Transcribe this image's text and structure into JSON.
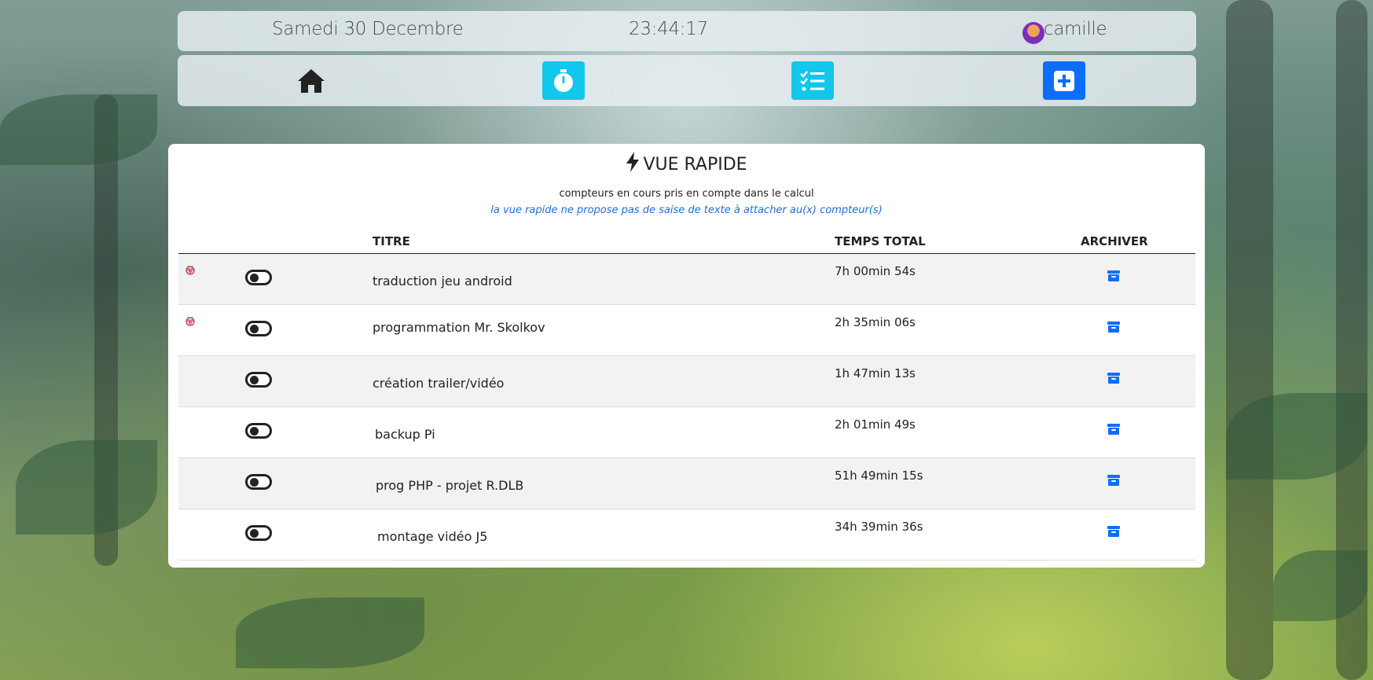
{
  "header": {
    "date": "Samedi 30 Decembre",
    "time": "23:44:17",
    "username": "camille",
    "avatar_icon": "user-avatar"
  },
  "nav": {
    "items": [
      {
        "icon": "home-icon"
      },
      {
        "icon": "stopwatch-icon"
      },
      {
        "icon": "task-list-icon"
      },
      {
        "icon": "add-square-icon"
      }
    ],
    "colors": {
      "cyan": "#13c6ec",
      "blue": "#0d6efd"
    }
  },
  "panel": {
    "title": "VUE RAPIDE",
    "title_icon": "bolt-icon",
    "subtitle": "compteurs en cours pris en compte dans le calcul",
    "note": "la vue rapide ne propose pas de saise de texte à attacher au(x) compteur(s)"
  },
  "table": {
    "headers": {
      "title": "TITRE",
      "total": "TEMPS TOTAL",
      "archive": "ARCHIVER"
    },
    "rows": [
      {
        "title": "traduction jeu android",
        "total": "7h 00min 54s",
        "flagged": true
      },
      {
        "title": "programmation Mr. Skolkov",
        "total": "2h 35min 06s",
        "flagged": true
      },
      {
        "title": "création trailer/vidéo",
        "total": "1h 47min 13s",
        "flagged": false
      },
      {
        "title": "backup Pi",
        "total": "2h 01min 49s",
        "flagged": false
      },
      {
        "title": "prog PHP - projet R.DLB",
        "total": "51h 49min 15s",
        "flagged": false
      },
      {
        "title": "montage vidéo J5",
        "total": "34h 39min 36s",
        "flagged": false
      }
    ]
  }
}
